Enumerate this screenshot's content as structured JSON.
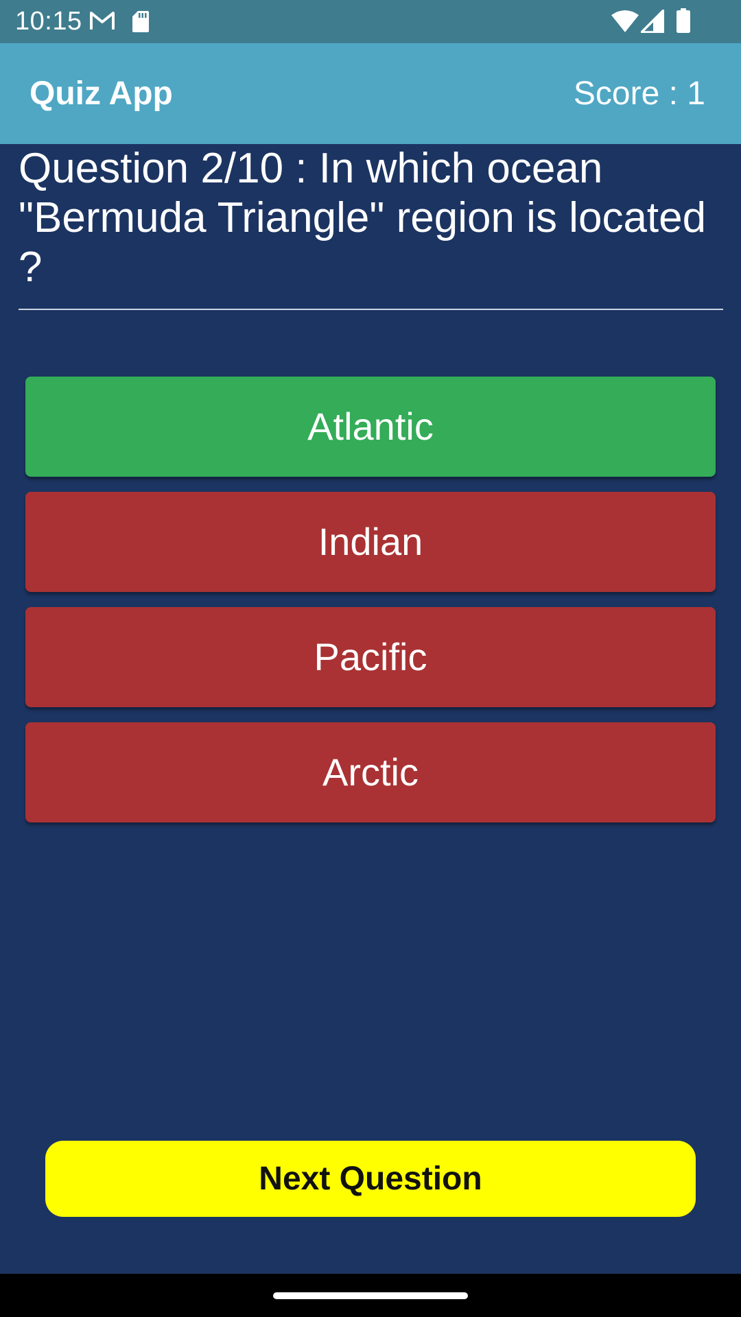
{
  "status_bar": {
    "time": "10:15",
    "icons": [
      "gmail-icon",
      "sd-card-icon",
      "wifi-icon",
      "cell-signal-icon",
      "battery-icon"
    ]
  },
  "app_bar": {
    "title": "Quiz App",
    "score": "Score : 1"
  },
  "question": {
    "text": "Question 2/10 : In which ocean \"Bermuda Triangle\" region is located ?"
  },
  "options": [
    {
      "label": "Atlantic",
      "state": "correct",
      "color": "#34ac58"
    },
    {
      "label": "Indian",
      "state": "wrong",
      "color": "#aa3234"
    },
    {
      "label": "Pacific",
      "state": "wrong",
      "color": "#aa3234"
    },
    {
      "label": "Arctic",
      "state": "wrong",
      "color": "#aa3234"
    }
  ],
  "next_button": {
    "label": "Next Question"
  },
  "colors": {
    "background": "#1c3461",
    "status_bar": "#3f7c8e",
    "app_bar": "#4fa7c4",
    "correct": "#34ac58",
    "wrong": "#aa3234",
    "next_button": "#ffff00"
  }
}
